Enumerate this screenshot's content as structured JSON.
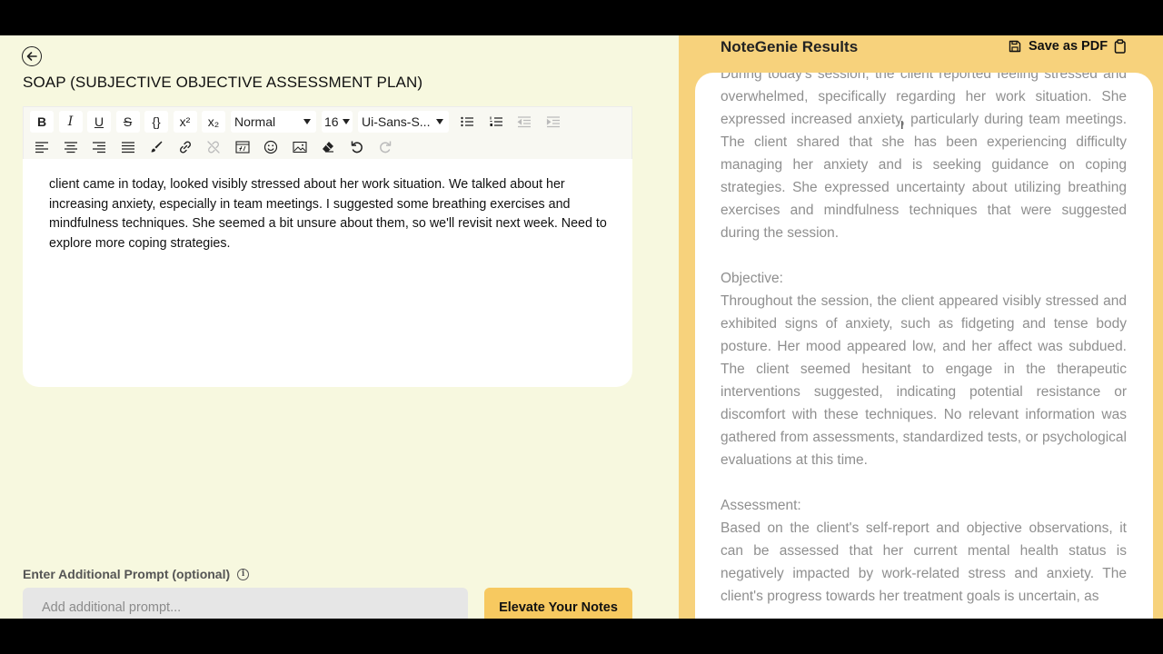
{
  "left": {
    "page_title": "SOAP (SUBJECTIVE OBJECTIVE ASSESSMENT PLAN)",
    "toolbar": {
      "bold": "B",
      "italic": "I",
      "underline": "U",
      "strike": "S",
      "code": "{}",
      "superscript": "x²",
      "subscript": "x₂",
      "block_format": "Normal",
      "font_size": "16",
      "font_family": "Ui-Sans-S..."
    },
    "editor_text": "client came in today, looked visibly stressed about her work situation. We talked about her increasing anxiety, especially in team meetings. I suggested some breathing exercises and mindfulness techniques. She seemed a bit unsure about them, so we'll revisit next week. Need to explore more coping strategies.",
    "prompt_label": "Enter Additional Prompt (optional)",
    "prompt_placeholder": "Add additional prompt...",
    "elevate_button": "Elevate Your Notes"
  },
  "right": {
    "title": "NoteGenie Results",
    "save_pdf": "Save as PDF",
    "subjective_text": "During today's session, the client reported feeling stressed and overwhelmed, specifically regarding her work situation. She expressed increased anxiety, particularly during team meetings. The client shared that she has been experiencing difficulty managing her anxiety and is seeking guidance on coping strategies. She expressed uncertainty about utilizing breathing exercises and mindfulness techniques that were suggested during the session.",
    "objective_heading": "Objective:",
    "objective_text": "Throughout the session, the client appeared visibly stressed and exhibited signs of anxiety, such as fidgeting and tense body posture. Her mood appeared low, and her affect was subdued. The client seemed hesitant to engage in the therapeutic interventions suggested, indicating potential resistance or discomfort with these techniques. No relevant information was gathered from assessments, standardized tests, or psychological evaluations at this time.",
    "assessment_heading": "Assessment:",
    "assessment_text": "Based on the client's self-report and objective observations, it can be assessed that her current mental health status is negatively impacted by work-related stress and anxiety. The client's progress towards her treatment goals is uncertain, as"
  },
  "colors": {
    "left_bg": "#f7f8df",
    "right_bg": "#f7d27c",
    "accent_button": "#f7c960",
    "result_text": "#8f8f8f"
  }
}
